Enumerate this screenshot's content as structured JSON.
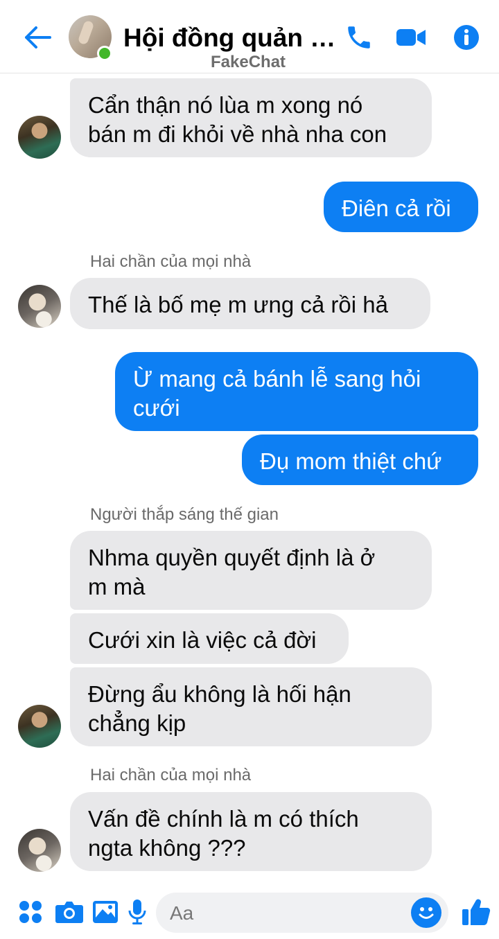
{
  "header": {
    "title": "Hội đồng quản t...",
    "watermark": "FakeChat",
    "back_icon": "arrow-left-icon",
    "call_icon": "phone-icon",
    "video_icon": "video-camera-icon",
    "info_icon": "info-icon",
    "accent_color": "#0d7ff3",
    "online_color": "#42b72a"
  },
  "messages": [
    {
      "type": "incoming",
      "text": "Cẩn thận nó lùa m xong nó\nbán m đi khỏi về nhà nha con"
    },
    {
      "type": "outgoing",
      "text": "Điên cả rồi"
    },
    {
      "type": "sender",
      "text": "Hai chần của mọi nhà"
    },
    {
      "type": "incoming",
      "text": "Thế là bố mẹ m ưng cả rồi hả"
    },
    {
      "type": "outgoing",
      "text": "Ừ mang cả bánh lễ sang hỏi\ncưới"
    },
    {
      "type": "outgoing",
      "text": "Đụ mom thiệt chứ"
    },
    {
      "type": "sender",
      "text": "Người thắp sáng thế gian"
    },
    {
      "type": "incoming",
      "text": "Nhma quyền quyết định là ở\nm mà"
    },
    {
      "type": "incoming",
      "text": "Cưới xin là việc cả đời"
    },
    {
      "type": "incoming",
      "text": "Đừng ẩu không là hối hận\nchẳng kịp"
    },
    {
      "type": "sender",
      "text": "Hai chần của mọi nhà"
    },
    {
      "type": "incoming",
      "text": "Vấn đề chính là m có thích\nngta không ???"
    }
  ],
  "composer": {
    "placeholder": "Aa",
    "icons": [
      "apps-icon",
      "camera-icon",
      "gallery-icon",
      "microphone-icon",
      "emoji-icon",
      "thumbs-up-icon"
    ]
  },
  "colors": {
    "outgoing_bubble": "#0d7ff3",
    "incoming_bubble": "#e8e8ea"
  }
}
